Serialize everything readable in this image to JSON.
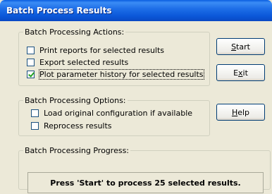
{
  "window": {
    "title": "Batch Process Results"
  },
  "actions": {
    "legend": "Batch Processing Actions:",
    "items": [
      {
        "label": "Print reports for selected results",
        "checked": false
      },
      {
        "label": "Export selected results",
        "checked": false
      },
      {
        "label": "Plot parameter history for selected results",
        "checked": true
      }
    ]
  },
  "options": {
    "legend": "Batch Processing Options:",
    "items": [
      {
        "label": "Load original configuration if available",
        "checked": false
      },
      {
        "label": "Reprocess results",
        "checked": false
      }
    ]
  },
  "progress": {
    "legend": "Batch Processing Progress:",
    "message": "Press 'Start' to process 25 selected results."
  },
  "buttons": {
    "start": {
      "mnemonic": "S",
      "rest": "tart"
    },
    "exit": {
      "pre": "E",
      "mnemonic": "x",
      "rest": "it"
    },
    "help": {
      "mnemonic": "H",
      "rest": "elp"
    }
  }
}
